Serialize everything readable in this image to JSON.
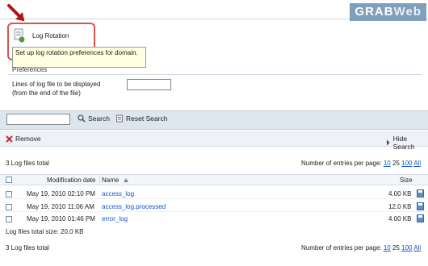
{
  "watermark": {
    "part1": "GRAB",
    "part2": "Web"
  },
  "log_rotation": {
    "label": "Log Rotation",
    "tooltip": "Set up log rotation preferences for domain."
  },
  "preferences": {
    "legend": "Preferences",
    "lines_label_1": "Lines of log file to be displayed",
    "lines_label_2": "(from the end of the file)",
    "lines_value": ""
  },
  "search": {
    "input_value": "",
    "search_label": "Search",
    "reset_label": "Reset Search"
  },
  "toolbar": {
    "remove_label": "Remove",
    "hide_search_label": "Hide Search"
  },
  "totals": {
    "top": "3 Log files total",
    "bottom": "3 Log files total",
    "size_total": "Log files total size: 20.0 KB"
  },
  "pager": {
    "label": "Number of entries per page:",
    "options": [
      "10",
      "25",
      "100",
      "All"
    ]
  },
  "table": {
    "headers": {
      "modified": "Modification date",
      "name": "Name",
      "size": "Size"
    },
    "rows": [
      {
        "date": "May 19, 2010 02:10 PM",
        "name": "access_log",
        "size": "4.00 KB"
      },
      {
        "date": "May 19, 2010 11:06 AM",
        "name": "access_log.processed",
        "size": "12.0 KB"
      },
      {
        "date": "May 19, 2010 01:46 PM",
        "name": "error_log",
        "size": "4.00 KB"
      }
    ]
  },
  "colors": {
    "link": "#1155cc",
    "highlight": "#d9534f",
    "tooltip_bg": "#ffffe1",
    "bar_bg": "#dde6ef"
  },
  "icons": [
    "arrow-icon",
    "log-file-icon",
    "search-icon",
    "reset-icon",
    "remove-icon",
    "hide-search-icon",
    "download-icon",
    "sort-asc-icon"
  ]
}
